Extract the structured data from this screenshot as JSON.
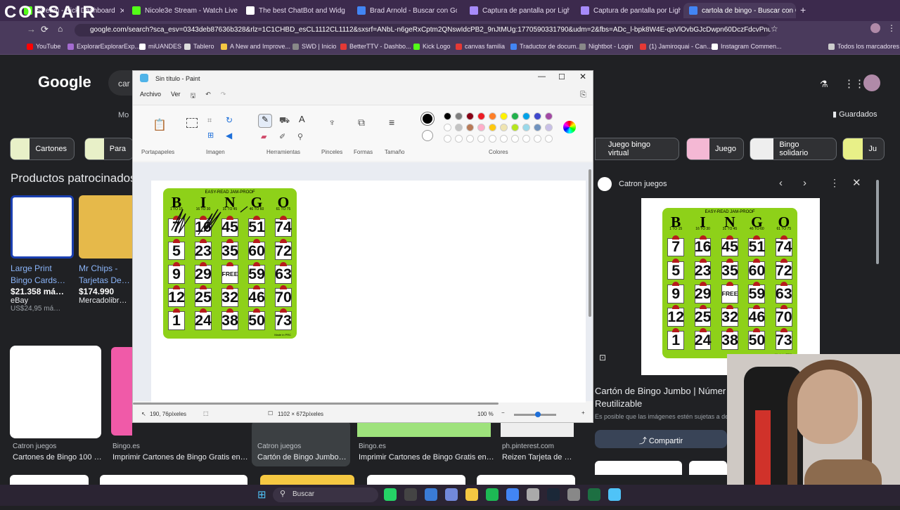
{
  "browser": {
    "brand": "CORSAIR",
    "tabs": [
      {
        "label": "Stream - Kick Dashboard",
        "color": "#53fc18"
      },
      {
        "label": "Nicole3e Stream - Watch Live o",
        "color": "#53fc18"
      },
      {
        "label": "The best ChatBot and Widg",
        "color": "#ffffff"
      },
      {
        "label": "Brad Arnold - Buscar con Goog",
        "color": "#4285f4"
      },
      {
        "label": "Captura de pantalla por Lightsh",
        "color": "#a78bfa"
      },
      {
        "label": "Captura de pantalla por Lightsh",
        "color": "#a78bfa"
      },
      {
        "label": "cartola de bingo - Buscar con G",
        "color": "#4285f4"
      }
    ],
    "url": "google.com/search?sca_esv=0343deb87636b328&rlz=1C1CHBD_esCL1112CL1112&sxsrf=ANbL-n6geRxCptm2QNswIdcPB2_9nJtMUg:1770590331790&udm=2&fbs=ADc_l-bpk8W4E-qsVlOvbGJcDwpn60DczFdcvPnuv8WQohHL...",
    "bookmarks": [
      "YouTube",
      "ExplorarExplorarExp...",
      "miUANDES",
      "Tablero",
      "A New and Improve...",
      "SWD | Inicio",
      "BetterTTV - Dashbo...",
      "Kick Logo",
      "canvas familia",
      "Traductor de docum...",
      "Nightbot - Login",
      "(1) Jamiroquai - Can...",
      "Instagram Commen..."
    ],
    "bookmarks_all": "Todos los marcadores"
  },
  "google": {
    "logo": "Google",
    "search_partial": "car",
    "chips": [
      "Cartones",
      "Para",
      "Juego bingo virtual",
      "Juego",
      "Bingo solidario",
      "Ju"
    ],
    "sponsored_title": "Productos patrocinados",
    "guardados": "Guardados",
    "products": [
      {
        "title": "Large Print Bingo Cards…",
        "price": "$21.358 má…",
        "store": "eBay",
        "extra": "US$24,95 má…"
      },
      {
        "title": "Mr Chips - Tarjetas De…",
        "price": "$174.990",
        "store": "Mercadolibr…",
        "extra": ""
      }
    ],
    "results": [
      {
        "source": "Catron juegos",
        "title": "Cartones de Bingo 100 …"
      },
      {
        "source": "Bingo.es",
        "title": "Imprimir Cartones de Bingo Gratis en…"
      },
      {
        "source": "Catron juegos",
        "title": "Cartón de Bingo Jumbo…"
      },
      {
        "source": "Bingo.es",
        "title": "Imprimir Cartones de Bingo Gratis en…"
      },
      {
        "source": "ph.pinterest.com",
        "title": "Reizen Tarjeta de …"
      }
    ]
  },
  "panel": {
    "source": "Catron juegos",
    "title": "Cartón de Bingo Jumbo | Númer Reutilizable",
    "caption": "Es posible que las imágenes estén sujetas a der",
    "share": "Compartir"
  },
  "paint": {
    "title": "Sin título - Paint",
    "menu": [
      "Archivo",
      "Ver"
    ],
    "groups": [
      "Portapapeles",
      "Imagen",
      "Herramientas",
      "Pinceles",
      "Formas",
      "Tamaño",
      "Colores"
    ],
    "status_pos": "190, 76píxeles",
    "status_size": "1102 × 672píxeles",
    "zoom": "100 %",
    "colors": [
      "#000000",
      "#7f7f7f",
      "#880015",
      "#ed1c24",
      "#ff7f27",
      "#fff200",
      "#22b14c",
      "#00a2e8",
      "#3f48cc",
      "#a349a4",
      "#ffffff",
      "#c3c3c3",
      "#b97a57",
      "#ffaec9",
      "#ffc90e",
      "#efe4b0",
      "#b5e61d",
      "#99d9ea",
      "#7092be",
      "#c8bfe7"
    ]
  },
  "bingo": {
    "top": "EASY-READ JAM-PROOF",
    "letters": [
      "B",
      "I",
      "N",
      "G",
      "O"
    ],
    "ranges": [
      "1 TO 15",
      "16 TO 30",
      "31 TO 45",
      "46 TO 60",
      "61 TO 75"
    ],
    "rows": [
      [
        "7",
        "16",
        "45",
        "51",
        "74"
      ],
      [
        "5",
        "23",
        "35",
        "60",
        "72"
      ],
      [
        "9",
        "29",
        "FREE",
        "59",
        "63"
      ],
      [
        "12",
        "25",
        "32",
        "46",
        "70"
      ],
      [
        "1",
        "24",
        "38",
        "50",
        "73"
      ]
    ],
    "made": "Made in PRC"
  },
  "taskbar": {
    "search": "Buscar"
  }
}
